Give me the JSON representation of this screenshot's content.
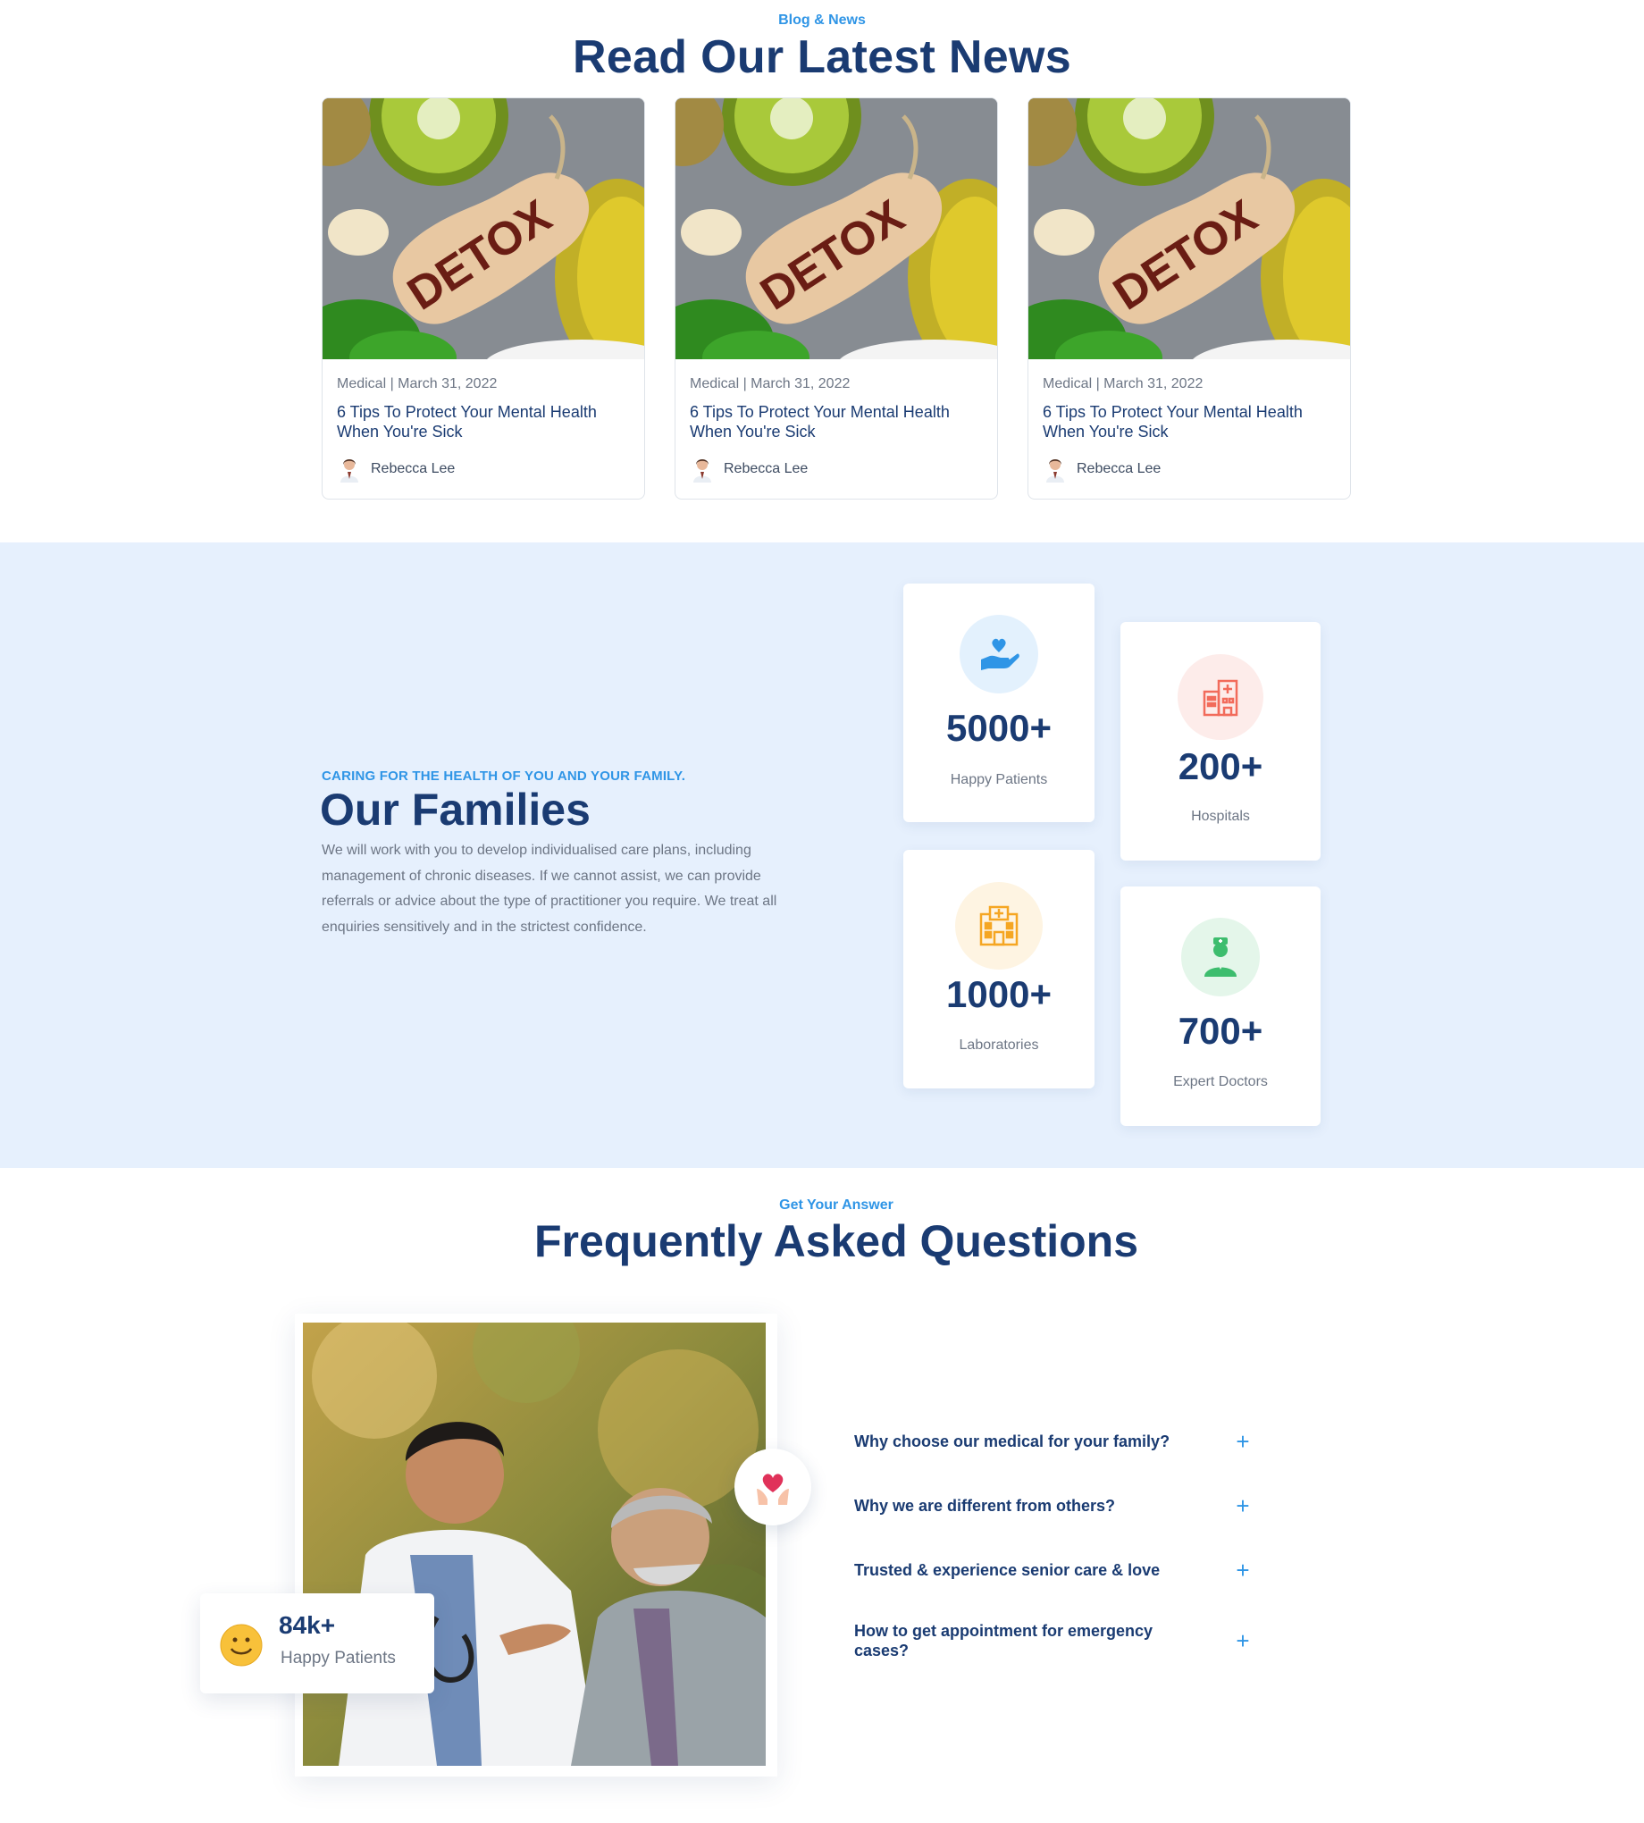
{
  "blog": {
    "eyebrow": "Blog & News",
    "title": "Read Our Latest News",
    "posts": [
      {
        "image_text": "DETOX",
        "meta": "Medical | March 31, 2022",
        "title": "6 Tips To Protect Your Mental Health When You're Sick",
        "author": "Rebecca Lee"
      },
      {
        "image_text": "DETOX",
        "meta": "Medical | March 31, 2022",
        "title": "6 Tips To Protect Your Mental Health When You're Sick",
        "author": "Rebecca Lee"
      },
      {
        "image_text": "DETOX",
        "meta": "Medical | March 31, 2022",
        "title": "6 Tips To Protect Your Mental Health When You're Sick",
        "author": "Rebecca Lee"
      }
    ]
  },
  "families": {
    "eyebrow": "CARING FOR THE HEALTH OF YOU AND YOUR FAMILY.",
    "title": "Our Families",
    "description": "We will work with you to develop individualised care plans, including management of chronic diseases. If we cannot assist, we can provide referrals or advice about the type of practitioner you require. We treat all enquiries sensitively and in the strictest confidence.",
    "stats": [
      {
        "icon": "heart-hand-icon",
        "value": "5000+",
        "label": "Happy Patients",
        "color": "#2f95e6"
      },
      {
        "icon": "hospital-icon",
        "value": "200+",
        "label": "Hospitals",
        "color": "#f26b5b"
      },
      {
        "icon": "laboratory-icon",
        "value": "1000+",
        "label": "Laboratories",
        "color": "#f5a623"
      },
      {
        "icon": "doctor-icon",
        "value": "700+",
        "label": "Expert Doctors",
        "color": "#3dbd6e"
      }
    ]
  },
  "faq": {
    "eyebrow": "Get Your Answer",
    "title": "Frequently Asked Questions",
    "badge": {
      "value": "84k+",
      "label": "Happy Patients"
    },
    "questions": [
      {
        "q": "Why choose our medical for your family?",
        "toggle": "+"
      },
      {
        "q": "Why we are different from others?",
        "toggle": "+"
      },
      {
        "q": "Trusted & experience senior care & love",
        "toggle": "+"
      },
      {
        "q": "How to get appointment for emergency cases?",
        "toggle": "+"
      }
    ]
  },
  "colors": {
    "accent": "#2f95e6",
    "navy": "#1a3b72",
    "section_bg": "#e6f0fd"
  }
}
